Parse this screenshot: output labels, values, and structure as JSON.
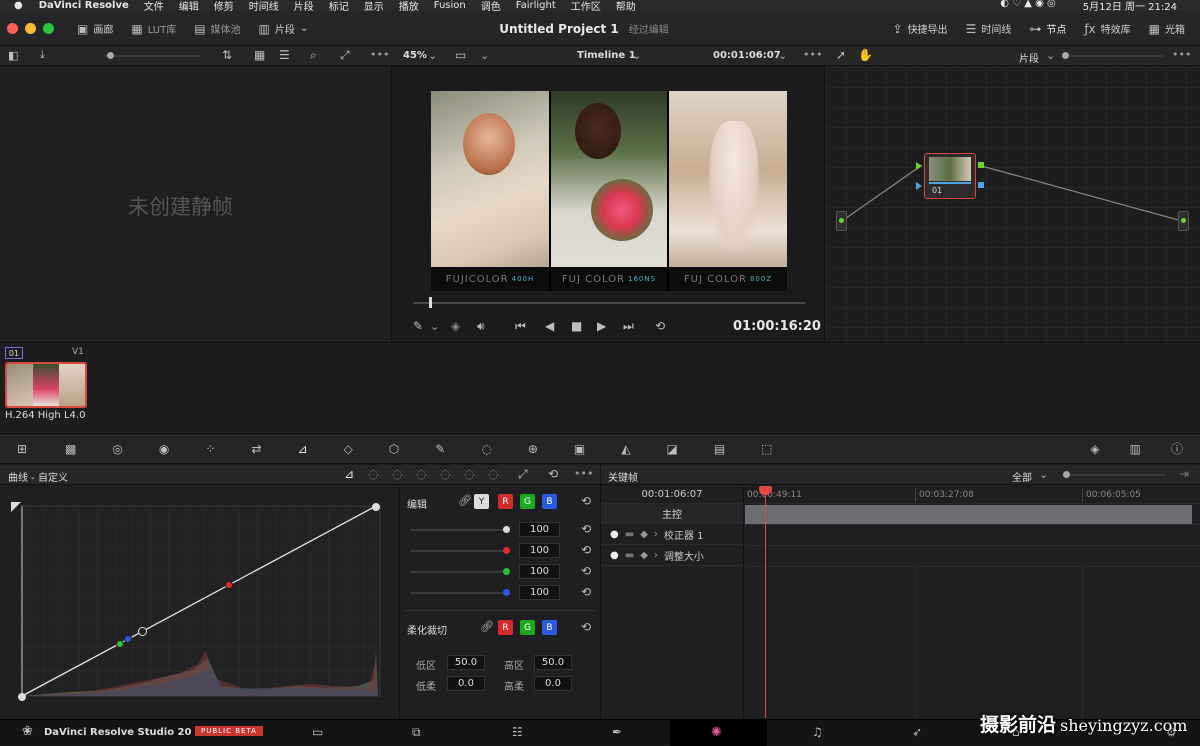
{
  "macbar": {
    "app_name": "DaVinci Resolve",
    "menus": [
      "文件",
      "编辑",
      "修剪",
      "时间线",
      "片段",
      "标记",
      "显示",
      "播放",
      "Fusion",
      "调色",
      "Fairlight",
      "工作区",
      "帮助"
    ],
    "clock": "5月12日 周一  21:24"
  },
  "toolbar": {
    "gallery": "画廊",
    "lut": "LUT库",
    "media_pool": "媒体池",
    "clips": "片段",
    "project_title": "Untitled Project 1",
    "edited": "经过编辑",
    "quick_export": "快捷导出",
    "timeline": "时间线",
    "nodes": "节点",
    "effects": "特效库",
    "lightbox": "光箱"
  },
  "subbar": {
    "zoom": "45%",
    "timeline_name": "Timeline 1",
    "timecode": "00:01:06:07",
    "clip_mode": "片段"
  },
  "stills": {
    "empty_text": "未创建静帧"
  },
  "viewer": {
    "panels": [
      {
        "brand": "FUJICOLOR",
        "code": "400H"
      },
      {
        "brand": "FUJ COLOR",
        "code": "160NS"
      },
      {
        "brand": "FUJ COLOR",
        "code": "800Z"
      }
    ],
    "playback_timecode": "01:00:16:20",
    "scrub_position": 0.04
  },
  "nodes": {
    "node_label": "01"
  },
  "clips": {
    "track_index": "01",
    "track_label": "V1",
    "codec": "H.264 High L4.0"
  },
  "curves": {
    "title": "曲线 - 自定义"
  },
  "edit_panel": {
    "title": "编辑",
    "channels": [
      "Y",
      "R",
      "G",
      "B"
    ],
    "sliders": [
      {
        "value": "100",
        "color": "#dddddd"
      },
      {
        "value": "100",
        "color": "#e02a2a"
      },
      {
        "value": "100",
        "color": "#2ec02e"
      },
      {
        "value": "100",
        "color": "#2a5ae0"
      }
    ],
    "soft_clip_title": "柔化裁切",
    "low_label": "低区",
    "low_value": "50.0",
    "high_label": "高区",
    "high_value": "50.0",
    "low_soft_label": "低柔",
    "low_soft_value": "0.0",
    "high_soft_label": "高柔",
    "high_soft_value": "0.0"
  },
  "keyframes": {
    "title": "关键帧",
    "filter": "全部",
    "current_tc": "00:01:06:07",
    "ticks": [
      "00:00:49:11",
      "00:03:27:08",
      "00:06:05:05"
    ],
    "master": "主控",
    "tracks": [
      "校正器 1",
      "调整大小"
    ]
  },
  "bottom": {
    "app": "DaVinci Resolve Studio 20",
    "badge": "PUBLIC BETA"
  },
  "watermark": {
    "text": "摄影前沿",
    "url": "sheyingzyz.com"
  }
}
